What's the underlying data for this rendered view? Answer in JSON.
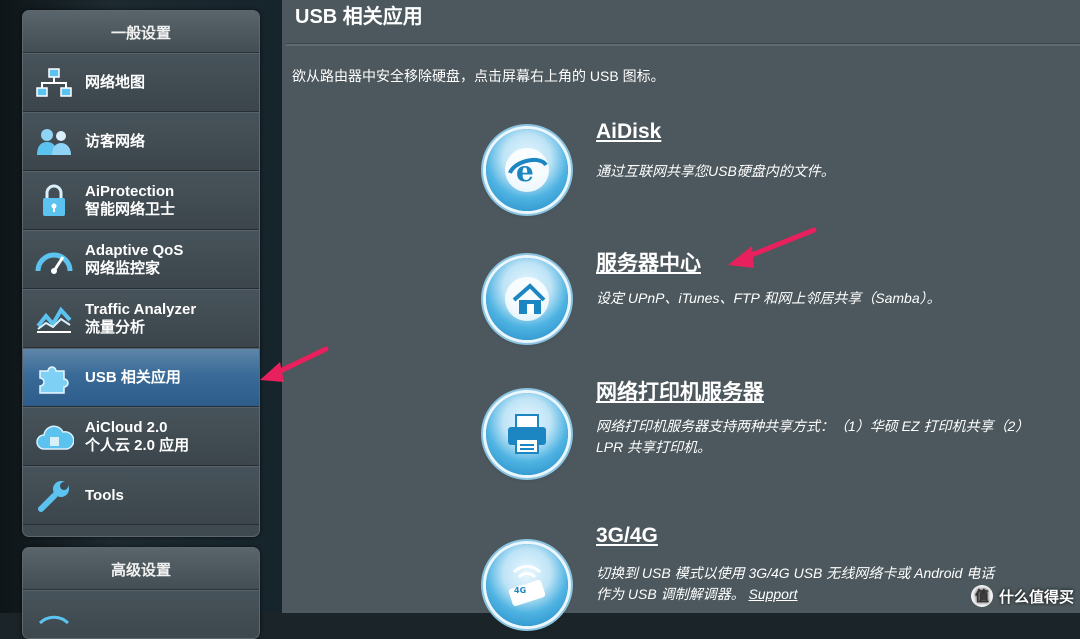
{
  "sidebar": {
    "general_header": "一般设置",
    "items": [
      {
        "icon": "network-map-icon",
        "lines": [
          "网络地图"
        ],
        "active": false
      },
      {
        "icon": "guest-network-icon",
        "lines": [
          "访客网络"
        ],
        "active": false
      },
      {
        "icon": "lock-shield-icon",
        "lines": [
          "AiProtection",
          "智能网络卫士"
        ],
        "active": false
      },
      {
        "icon": "speedometer-icon",
        "lines": [
          "Adaptive QoS",
          "网络监控家"
        ],
        "active": false
      },
      {
        "icon": "traffic-graph-icon",
        "lines": [
          "Traffic Analyzer",
          "流量分析"
        ],
        "active": false
      },
      {
        "icon": "puzzle-icon",
        "lines": [
          "USB 相关应用"
        ],
        "active": true
      },
      {
        "icon": "cloud-icon",
        "lines": [
          "AiCloud 2.0",
          "个人云 2.0 应用"
        ],
        "active": false
      },
      {
        "icon": "wrench-icon",
        "lines": [
          "Tools"
        ],
        "active": false
      }
    ],
    "advanced_header": "高级设置"
  },
  "main": {
    "title": "USB 相关应用",
    "hint": "欲从路由器中安全移除硬盘，点击屏幕右上角的 USB 图标。",
    "apps": [
      {
        "icon": "aidisk-globe-icon",
        "title": "AiDisk",
        "desc": "通过互联网共享您USB硬盘内的文件。"
      },
      {
        "icon": "server-center-house-icon",
        "title": "服务器中心",
        "desc": "设定 UPnP、iTunes、FTP 和网上邻居共享（Samba）。"
      },
      {
        "icon": "printer-icon",
        "title": "网络打印机服务器",
        "desc": "网络打印机服务器支持两种共享方式：（1）华硕 EZ 打印机共享（2）LPR 共享打印机。"
      },
      {
        "icon": "usb-modem-icon",
        "title": "3G/4G",
        "desc": "切换到 USB 模式以使用 3G/4G USB 无线网络卡或 Android 电话作为 USB 调制解调器。",
        "link": "Support"
      }
    ]
  },
  "watermark": {
    "badge": "值",
    "text": "什么值得买"
  },
  "colors": {
    "accent_arrow": "#e8205e",
    "active_item": "#3a6b98",
    "content_bg": "#4c585d"
  }
}
